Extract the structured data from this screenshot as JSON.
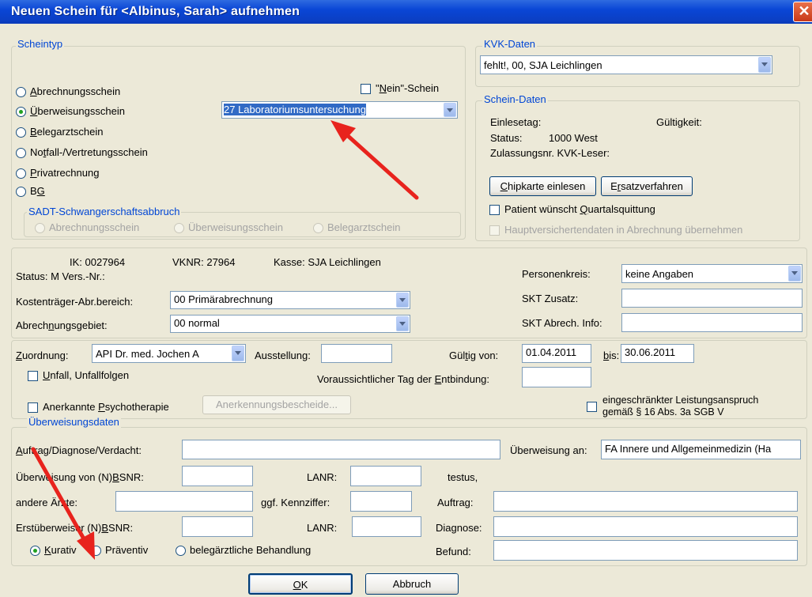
{
  "window": {
    "title": "Neuen Schein für <Albinus, Sarah> aufnehmen",
    "close_glyph": "✕"
  },
  "scheintyp": {
    "legend": "Scheintyp",
    "options": [
      {
        "pre": "",
        "acc": "A",
        "post": "brechnungsschein"
      },
      {
        "pre": "",
        "acc": "Ü",
        "post": "berweisungsschein"
      },
      {
        "pre": "",
        "acc": "B",
        "post": "elegarztschein"
      },
      {
        "pre": "No",
        "acc": "t",
        "post": "fall-/Vertretungsschein"
      },
      {
        "pre": "",
        "acc": "P",
        "post": "rivatrechnung"
      },
      {
        "pre": "B",
        "acc": "G",
        "post": ""
      }
    ],
    "nein_schein": {
      "pre": "\"",
      "acc": "N",
      "post": "ein\"-Schein"
    },
    "ueberweisung_combo": "27  Laboratoriumsuntersuchung",
    "sadt_legend": "SADT-Schwangerschaftsabbruch",
    "sadt_options": [
      "Abrechnungsschein",
      "Überweisungsschein",
      "Belegarztschein"
    ]
  },
  "kvk": {
    "legend": "KVK-Daten",
    "value": "fehlt!, 00, SJA Leichlingen"
  },
  "schein_daten": {
    "legend": "Schein-Daten",
    "einlesetag": "Einlesetag:",
    "gueltigkeit": "Gültigkeit:",
    "status_label": "Status:",
    "status_value": "1000 West",
    "zulassung": "Zulassungsnr. KVK-Leser:",
    "chipkarte_btn": {
      "pre": "",
      "acc": "C",
      "post": "hipkarte einlesen"
    },
    "ersatz_btn": {
      "pre": "E",
      "acc": "r",
      "post": "satzverfahren"
    },
    "quartal": {
      "pre": "Patient wünscht ",
      "acc": "Q",
      "post": "uartalsquittung"
    },
    "haupt": "Hauptversichertendaten in Abrechnung übernehmen"
  },
  "kasse": {
    "ik": "IK: 0027964",
    "vknr": "VKNR: 27964",
    "kasse": "Kasse: SJA Leichlingen",
    "status": "Status:  M  Vers.-Nr.:",
    "kostentraeger_label": "Kostenträger-Abr.bereich:",
    "kostentraeger_value": "00  Primärabrechnung",
    "abrechnung_label": {
      "pre": "Abrech",
      "acc": "n",
      "post": "ungsgebiet:"
    },
    "abrechnung_value": "00  normal",
    "personenkreis_label": "Personenkreis:",
    "personenkreis_value": "keine Angaben",
    "skt_zusatz_label": "SKT Zusatz:",
    "skt_info_label": "SKT Abrech. Info:"
  },
  "zuordnung": {
    "label": {
      "pre": "",
      "acc": "Z",
      "post": "uordnung:"
    },
    "value": "API    Dr. med. Jochen A",
    "ausstellung_label": "Ausstellung:",
    "gueltig_label": {
      "pre": "Gül",
      "acc": "t",
      "post": "ig von:"
    },
    "gueltig_von": "01.04.2011",
    "bis_label": {
      "pre": "",
      "acc": "b",
      "post": "is:"
    },
    "bis_value": "30.06.2011",
    "unfall": {
      "pre": "",
      "acc": "U",
      "post": "nfall, Unfallfolgen"
    },
    "entbindung": {
      "pre": "Voraussichtlicher Tag der ",
      "acc": "E",
      "post": "ntbindung:"
    },
    "psycho": {
      "pre": "Anerkannte ",
      "acc": "P",
      "post": "sychotherapie"
    },
    "anerkennung_btn": "Anerkennungsbescheide...",
    "leistung_line1": "eingeschränkter Leistungsanspruch",
    "leistung_line2": "gemäß § 16 Abs. 3a SGB V"
  },
  "ueberweisungsdaten": {
    "legend": "Überweisungsdaten",
    "auftrag_label": {
      "pre": "",
      "acc": "A",
      "post": "uftrag/Diagnose/Verdacht:"
    },
    "ueberweisung_an_label": "Überweisung an:",
    "ueberweisung_an_value": "FA Innere und Allgemeinmedizin (Ha",
    "von_label": {
      "pre": "Überweisung von (N)",
      "acc": "B",
      "post": "SNR:"
    },
    "lanr_label": "LANR:",
    "testus": "testus,",
    "andere_label": "andere Ärzte:",
    "kennziffer_label": "ggf. Kennziffer:",
    "auftrag2_label": "Auftrag:",
    "erst_label": {
      "pre": "Erstüberweiser (N)",
      "acc": "B",
      "post": "SNR:"
    },
    "lanr2_label": "LANR:",
    "diagnose_label": "Diagnose:",
    "befund_label": "Befund:",
    "kurativ": {
      "pre": "",
      "acc": "K",
      "post": "urativ"
    },
    "praeventiv": "Präventiv",
    "beleg": "belegärztliche Behandlung"
  },
  "buttons": {
    "ok": {
      "pre": "",
      "acc": "O",
      "post": "K"
    },
    "abbruch": "Abbruch"
  },
  "colors": {
    "titlebar": "#0a46d6",
    "legend": "#0046d5",
    "annotation_arrow": "#e8231d"
  }
}
